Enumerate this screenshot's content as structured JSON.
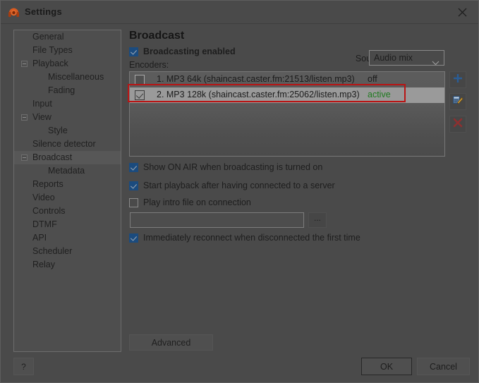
{
  "window": {
    "title": "Settings",
    "icon": "headset-microphone-icon",
    "close_label": "close-icon"
  },
  "sidebar": {
    "items": [
      {
        "label": "General",
        "level": 0,
        "expander": false,
        "selected": false
      },
      {
        "label": "File Types",
        "level": 0,
        "expander": false,
        "selected": false
      },
      {
        "label": "Playback",
        "level": 0,
        "expander": true,
        "selected": false
      },
      {
        "label": "Miscellaneous",
        "level": 1,
        "expander": false,
        "selected": false
      },
      {
        "label": "Fading",
        "level": 1,
        "expander": false,
        "selected": false
      },
      {
        "label": "Input",
        "level": 0,
        "expander": false,
        "selected": false
      },
      {
        "label": "View",
        "level": 0,
        "expander": true,
        "selected": false
      },
      {
        "label": "Style",
        "level": 1,
        "expander": false,
        "selected": false
      },
      {
        "label": "Silence detector",
        "level": 0,
        "expander": false,
        "selected": false
      },
      {
        "label": "Broadcast",
        "level": 0,
        "expander": true,
        "selected": true
      },
      {
        "label": "Metadata",
        "level": 1,
        "expander": false,
        "selected": false
      },
      {
        "label": "Reports",
        "level": 0,
        "expander": false,
        "selected": false
      },
      {
        "label": "Video",
        "level": 0,
        "expander": false,
        "selected": false
      },
      {
        "label": "Controls",
        "level": 0,
        "expander": false,
        "selected": false
      },
      {
        "label": "DTMF",
        "level": 0,
        "expander": false,
        "selected": false
      },
      {
        "label": "API",
        "level": 0,
        "expander": false,
        "selected": false
      },
      {
        "label": "Scheduler",
        "level": 0,
        "expander": false,
        "selected": false
      },
      {
        "label": "Relay",
        "level": 0,
        "expander": false,
        "selected": false
      }
    ]
  },
  "main": {
    "page_title": "Broadcast",
    "broadcasting_enabled": {
      "label": "Broadcasting enabled",
      "checked": true
    },
    "source": {
      "label": "Source:",
      "value": "Audio mix",
      "options": [
        "Audio mix"
      ]
    },
    "encoders_label": "Encoders:",
    "encoders": [
      {
        "name": "1. MP3 64k (shaincast.caster.fm:21513/listen.mp3)",
        "status": "off",
        "checked": false,
        "selected": false,
        "active": false
      },
      {
        "name": "2. MP3 128k (shaincast.caster.fm:25062/listen.mp3)",
        "status": "active",
        "checked": true,
        "selected": true,
        "active": true
      }
    ],
    "list_tools": [
      {
        "name": "add-encoder-button",
        "icon": "plus-icon"
      },
      {
        "name": "edit-encoder-button",
        "icon": "edit-pencil-icon"
      },
      {
        "name": "delete-encoder-button",
        "icon": "cross-icon"
      }
    ],
    "options": [
      {
        "label": "Show ON AIR when broadcasting is turned on",
        "checked": true
      },
      {
        "label": "Start playback after having connected to a server",
        "checked": true
      },
      {
        "label": "Play intro file on connection",
        "checked": false
      },
      {
        "label": "Immediately reconnect when disconnected the first time",
        "checked": true
      }
    ],
    "intro_file": {
      "value": "",
      "placeholder": ""
    },
    "browse_label": "...",
    "advanced_label": "Advanced"
  },
  "footer": {
    "help_label": "?",
    "ok_label": "OK",
    "cancel_label": "Cancel"
  },
  "colors": {
    "accent_checkbox": "#1b4b7e",
    "active_status": "#1f7a1f",
    "annotation_highlight": "#b91414",
    "window_bg": "#4a4a4a"
  }
}
